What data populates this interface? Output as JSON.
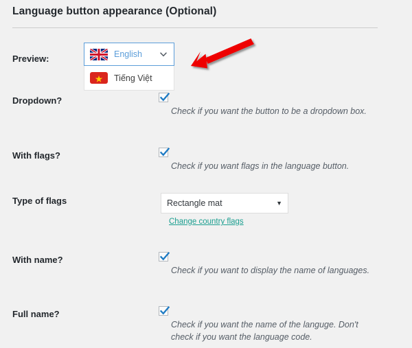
{
  "section": {
    "title": "Language button appearance (Optional)"
  },
  "preview": {
    "label": "Preview:",
    "selected": {
      "name": "English",
      "flag": "uk-flag-icon",
      "flag_colors": {
        "field": "#00247d",
        "cross": "#cf142b",
        "stripe": "#ffffff"
      }
    },
    "options": [
      {
        "name": "Tiếng Việt",
        "flag": "vietnam-flag-icon",
        "flag_colors": {
          "field": "#da251d",
          "star": "#ffcd00"
        }
      }
    ],
    "caret_icon": "chevron-down-icon"
  },
  "annotation": {
    "arrow_icon": "red-arrow-icon",
    "color": "#ee0000"
  },
  "rows": [
    {
      "id": "dropdown",
      "label": "Dropdown?",
      "control": "checkbox",
      "checked": true,
      "description": "Check if you want the button to be a dropdown box."
    },
    {
      "id": "with-flags",
      "label": "With flags?",
      "control": "checkbox",
      "checked": true,
      "description": "Check if you want flags in the language button."
    },
    {
      "id": "type-of-flags",
      "label": "Type of flags",
      "control": "select",
      "value": "Rectangle mat",
      "link_label": "Change country flags"
    },
    {
      "id": "with-name",
      "label": "With name?",
      "control": "checkbox",
      "checked": true,
      "description": "Check if you want to display the name of languages."
    },
    {
      "id": "full-name",
      "label": "Full name?",
      "control": "checkbox",
      "checked": true,
      "description": "Check if you want the name of the languge. Don't check if you want the language code."
    }
  ],
  "colors": {
    "background": "#f1f1f1",
    "heading": "#23282d",
    "focus_border": "#5b9dd9",
    "link": "#1a9e8f",
    "checkmark": "#1e7bc4",
    "arrow": "#ee0000"
  }
}
